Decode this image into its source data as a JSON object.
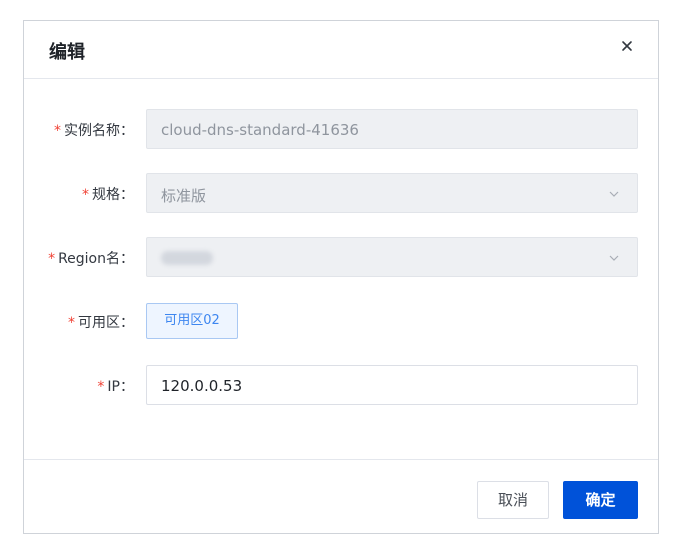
{
  "dialog": {
    "title": "编辑",
    "close_icon": "close-icon"
  },
  "form": {
    "instance_name": {
      "required_mark": "*",
      "label": "实例名称：",
      "value": "cloud-dns-standard-41636"
    },
    "spec": {
      "required_mark": "*",
      "label": "规格：",
      "value": "标准版",
      "icon": "chevron-down-icon"
    },
    "region": {
      "required_mark": "*",
      "label": "Region名：",
      "value_obscured": true,
      "icon": "chevron-down-icon"
    },
    "zone": {
      "required_mark": "*",
      "label": "可用区：",
      "tag": "可用区02"
    },
    "ip": {
      "required_mark": "*",
      "label": "IP：",
      "value": "120.0.0.53"
    }
  },
  "footer": {
    "cancel_label": "取消",
    "confirm_label": "确定"
  },
  "colors": {
    "primary": "#0052d9",
    "required": "#f04134",
    "tag_text": "#3d86f0"
  }
}
